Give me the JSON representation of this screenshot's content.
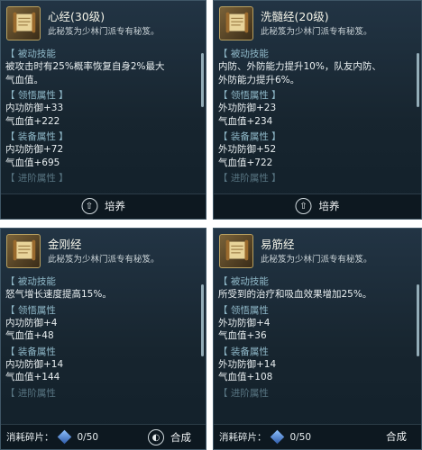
{
  "panels": [
    {
      "icon": "scroll-icon",
      "title": "心经(30级)",
      "subtitle": "此秘笈为少林门派专有秘笈。",
      "passive_header": "【 被动技能",
      "passive_lines": [
        "被攻击时有25%概率恢复自身2%最大",
        "气血值。"
      ],
      "comprehension_header": "【 领悟属性 】",
      "comprehension_lines": [
        "内功防御+33",
        "气血值+222"
      ],
      "equip_header": "【 装备属性 】",
      "equip_lines": [
        "内功防御+72",
        "气血值+695"
      ],
      "advance_header": "【 进阶属性 】",
      "action_icon": "cultivate-icon",
      "action_label": "培养"
    },
    {
      "icon": "scroll-icon",
      "title": "洗髓经(20级)",
      "subtitle": "此秘笈为少林门派专有秘笈。",
      "passive_header": "【 被动技能",
      "passive_lines": [
        "内防、外防能力提升10%，队友内防、",
        "外防能力提升6%。"
      ],
      "comprehension_header": "【 领悟属性 】",
      "comprehension_lines": [
        "外功防御+23",
        "气血值+234"
      ],
      "equip_header": "【 装备属性 】",
      "equip_lines": [
        "外功防御+52",
        "气血值+722"
      ],
      "advance_header": "【 进阶属性 】",
      "action_icon": "cultivate-icon",
      "action_label": "培养"
    },
    {
      "icon": "scroll-icon",
      "title": "金刚经",
      "subtitle": "此秘笈为少林门派专有秘笈。",
      "passive_header": "【 被动技能",
      "passive_lines": [
        "怒气增长速度提高15%。"
      ],
      "comprehension_header": "【 领悟属性",
      "comprehension_lines": [
        "内功防御+4",
        "气血值+48"
      ],
      "equip_header": "【 装备属性",
      "equip_lines": [
        "内功防御+14",
        "气血值+144"
      ],
      "advance_header": "【 进阶属性",
      "fragments_label": "消耗碎片：",
      "fragments_count": "0/50",
      "action_icon": "synthesize-icon",
      "action_label": "合成"
    },
    {
      "icon": "scroll-icon",
      "title": "易筋经",
      "subtitle": "此秘笈为少林门派专有秘笈。",
      "passive_header": "【 被动技能",
      "passive_lines": [
        "所受到的治疗和吸血效果增加25%。"
      ],
      "comprehension_header": "【 领悟属性",
      "comprehension_lines": [
        "外功防御+4",
        "气血值+36"
      ],
      "equip_header": "【 装备属性",
      "equip_lines": [
        "外功防御+14",
        "气血值+108"
      ],
      "advance_header": "【 进阶属性",
      "fragments_label": "消耗碎片：",
      "fragments_count": "0/50",
      "action_label": "合成"
    }
  ]
}
